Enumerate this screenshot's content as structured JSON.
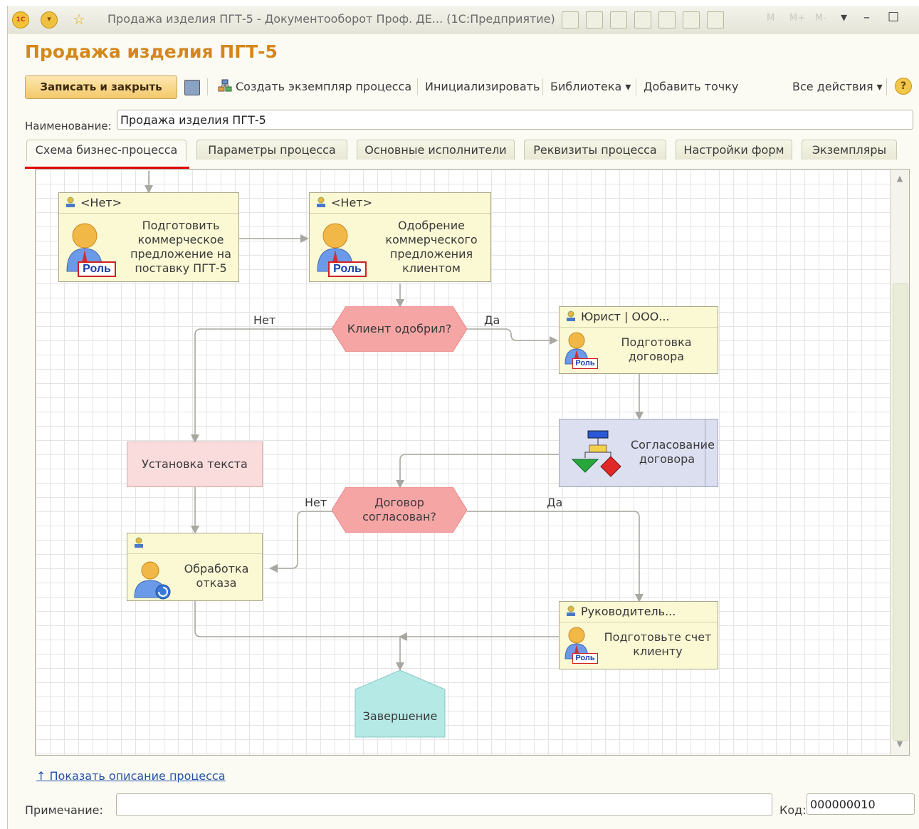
{
  "titlebar": {
    "title": "Продажа изделия ПГТ-5 - Документооборот Проф. ДЕ... (1С:Предприятие)",
    "logo": "1С",
    "m1": "M",
    "m2": "M+",
    "m3": "M-"
  },
  "form": {
    "title": "Продажа изделия ПГТ-5"
  },
  "toolbar": {
    "write_close": "Записать и закрыть",
    "create_instance": "Создать экземпляр процесса",
    "initialize": "Инициализировать",
    "library": "Библиотека ▾",
    "add_point": "Добавить точку",
    "all_actions": "Все действия ▾",
    "help": "?"
  },
  "name_field": {
    "label": "Наименование:",
    "value": "Продажа изделия ПГТ-5"
  },
  "tabs": [
    {
      "label": "Схема бизнес-процесса",
      "active": true
    },
    {
      "label": "Параметры процесса"
    },
    {
      "label": "Основные исполнители"
    },
    {
      "label": "Реквизиты процесса"
    },
    {
      "label": "Настройки форм"
    },
    {
      "label": "Экземпляры"
    }
  ],
  "flow": {
    "task1": {
      "head": "<Нет>",
      "text": "Подготовить коммерческое предложение на поставку ПГТ-5"
    },
    "task2": {
      "head": "<Нет>",
      "text": "Одобрение коммерческого предложения клиентом"
    },
    "cond1": {
      "text": "Клиент одобрил?",
      "no": "Нет",
      "yes": "Да"
    },
    "task3": {
      "head": "Юрист | ООО...",
      "text": "Подготовка договора"
    },
    "subproc": {
      "text": "Согласование договора"
    },
    "setText": {
      "text": "Установка текста"
    },
    "cond2": {
      "text": "Договор согласован?",
      "no": "Нет",
      "yes": "Да"
    },
    "task4": {
      "head": "",
      "text": "Обработка отказа"
    },
    "task5": {
      "head": "Руководитель...",
      "text": "Подготовьте счет клиенту"
    },
    "end": {
      "text": "Завершение"
    },
    "role_badge": "Роль"
  },
  "footer": {
    "show_desc": "↑ Показать описание процесса",
    "note_label": "Примечание:",
    "note_value": "",
    "code_label": "Код:",
    "code_value": "000000010"
  },
  "colors": {
    "title_orange": "#d4871a",
    "node_fill": "#fbf8d4",
    "decision_fill": "#f6a5a5",
    "end_fill": "#b4e9e6",
    "subproc_fill": "#dcdff0",
    "textset_fill": "#fbdcdc",
    "tab_underline": "#e00000"
  }
}
